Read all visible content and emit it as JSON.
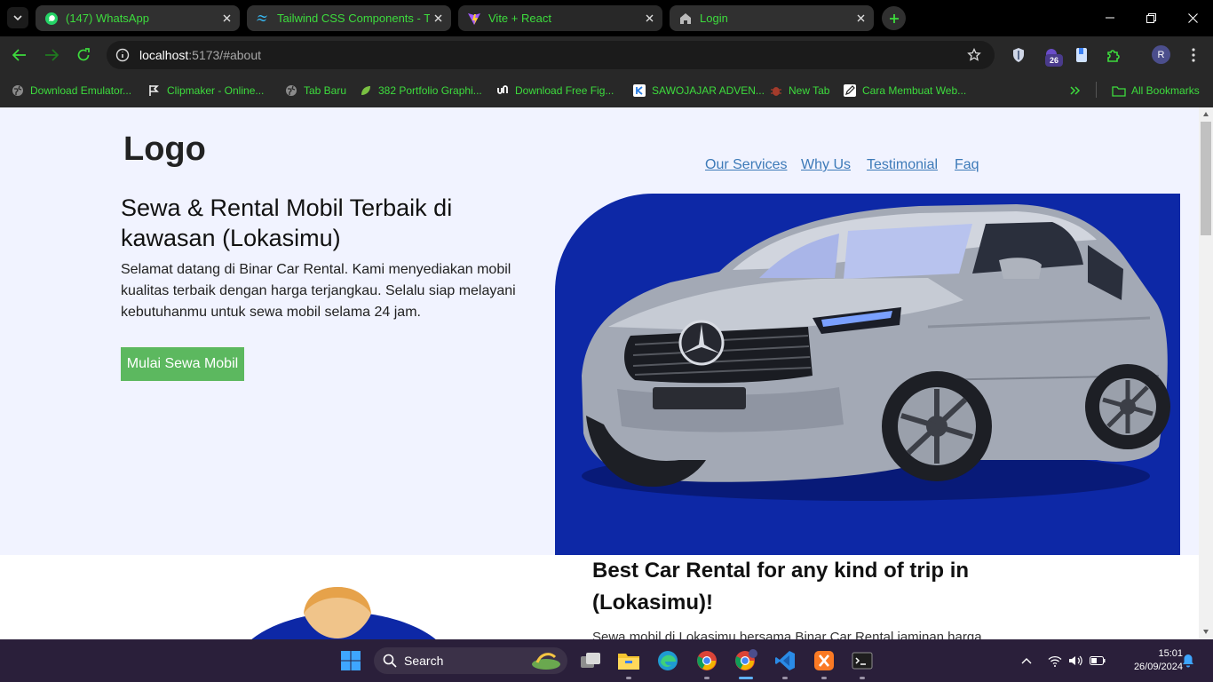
{
  "browser": {
    "tabs": [
      {
        "title": "(147) WhatsApp",
        "icon": "whatsapp-icon"
      },
      {
        "title": "Tailwind CSS Components - Tail",
        "icon": "tailwind-icon"
      },
      {
        "title": "Vite + React",
        "icon": "vite-icon",
        "active": true
      },
      {
        "title": "Login",
        "icon": "home-icon"
      }
    ],
    "address": {
      "host": "localhost",
      "path": ":5173/#about"
    },
    "extension_badge": "26",
    "profile_initial": "R",
    "bookmarks": [
      {
        "label": "Download Emulator...",
        "icon": "globe-icon"
      },
      {
        "label": "Clipmaker - Online...",
        "icon": "clipmaker-icon"
      },
      {
        "label": "Tab Baru",
        "icon": "globe-icon"
      },
      {
        "label": "382 Portfolio Graphi...",
        "icon": "leaf-icon"
      },
      {
        "label": "Download Free Fig...",
        "icon": "ui8-icon"
      },
      {
        "label": "SAWOJAJAR ADVEN...",
        "icon": "k-icon"
      },
      {
        "label": "New Tab",
        "icon": "bug-icon"
      },
      {
        "label": "Cara Membuat Web...",
        "icon": "pencil-icon"
      }
    ],
    "all_bookmarks": "All Bookmarks"
  },
  "page": {
    "logo": "Logo",
    "nav": [
      "Our Services",
      "Why Us",
      "Testimonial",
      "Faq"
    ],
    "hero_title": "Sewa & Rental Mobil Terbaik di kawasan (Lokasimu)",
    "hero_desc": "Selamat datang di Binar Car Rental. Kami menyediakan mobil kualitas terbaik dengan harga terjangkau. Selalu siap melayani kebutuhanmu untuk sewa mobil selama 24 jam.",
    "cta": "Mulai Sewa Mobil",
    "about_title": "Best Car Rental for any kind of trip in (Lokasimu)!",
    "about_text": "Sewa mobil di Lokasimu bersama Binar Car Rental jaminan harga",
    "colors": {
      "hero_bg": "#f1f3ff",
      "car_bg": "#0d28a6",
      "cta": "#5cb85f",
      "link": "#3d7ab8"
    }
  },
  "taskbar": {
    "search": "Search",
    "time": "15:01",
    "date": "26/09/2024"
  }
}
